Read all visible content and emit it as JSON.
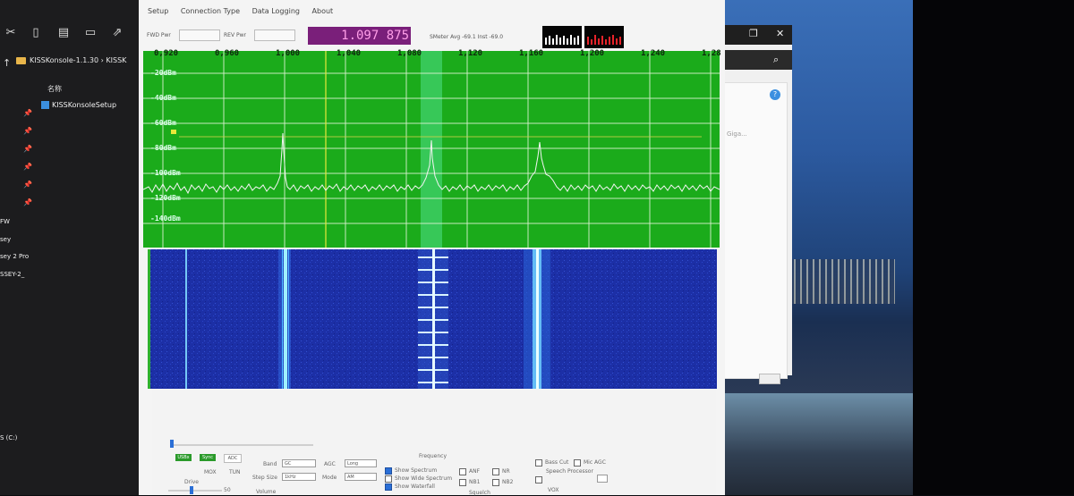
{
  "explorer": {
    "address": "KISSKonsole-1.1.30",
    "address_tail": "KISSK",
    "column_name": "名称",
    "file": "KISSKonsoleSetup",
    "nav": [
      "FW",
      "sey",
      "sey 2 Pro",
      "SSEY-2_",
      "S (C:)"
    ]
  },
  "kiss": {
    "menu": [
      "Setup",
      "Connection Type",
      "Data Logging",
      "About"
    ],
    "fwd_label": "FWD Pwr",
    "rev_label": "REV Pwr",
    "frequency": "1.097 875",
    "smeter": "SMeter  Avg -69.1   Inst -69.0",
    "freq_ticks": [
      "0,920",
      "0,960",
      "1,000",
      "1,040",
      "1,080",
      "1,120",
      "1,160",
      "1,200",
      "1,240",
      "1,28"
    ],
    "db_labels": [
      "-20dBm",
      "-40dBm",
      "-60dBm",
      "-80dBm",
      "-100dBm",
      "-120dBm",
      "-140dBm"
    ],
    "controls": {
      "btn_usb": "USBx",
      "btn_sync": "Sync",
      "btn_adc": "ADC",
      "mox": "MOX",
      "tune": "TUN",
      "drive": "Drive",
      "drive_value": "50",
      "band_label": "Band",
      "band_value": "GC",
      "step_label": "Step Size",
      "step_value": "1kHz",
      "volume": "Volume",
      "agc_label": "AGC",
      "agc_value": "Long",
      "mode_label": "Mode",
      "mode_value": "AM",
      "frequency_label": "Frequency",
      "show_spectrum": "Show Spectrum",
      "show_wide": "Show Wide Spectrum",
      "show_waterfall": "Show Waterfall",
      "anf": "ANF",
      "nr": "NR",
      "nb1": "NB1",
      "nb2": "NB2",
      "squelch": "Squelch",
      "bass_cut": "Bass Cut",
      "mic_agc": "Mic AGC",
      "speech_processor": "Speech Processor",
      "vox": "VOX"
    }
  },
  "bgwin": {
    "info": "Giga..."
  }
}
